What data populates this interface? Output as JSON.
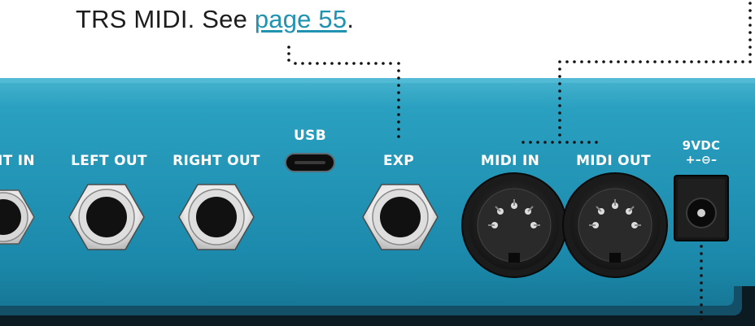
{
  "caption": {
    "text_before": "TRS MIDI. See ",
    "link_text": "page 55",
    "text_after": "."
  },
  "ports": {
    "right_in": "HT IN",
    "left_out": "LEFT OUT",
    "right_out": "RIGHT OUT",
    "usb": "USB",
    "exp": "EXP",
    "midi_in": "MIDI IN",
    "midi_out": "MIDI OUT",
    "power": "9VDC",
    "power_polarity": "+–⊖–"
  },
  "colors": {
    "panel_top": "#3aa9c6",
    "panel_mid": "#1e8fb0",
    "panel_bottom": "#17789a",
    "jack_nut": "#f0f0f0",
    "jack_hole": "#111111",
    "link": "#1f93b0"
  },
  "icons": [
    "quarter-inch-jack-icon",
    "usb-c-port-icon",
    "din-5-midi-icon",
    "dc-barrel-jack-icon"
  ]
}
